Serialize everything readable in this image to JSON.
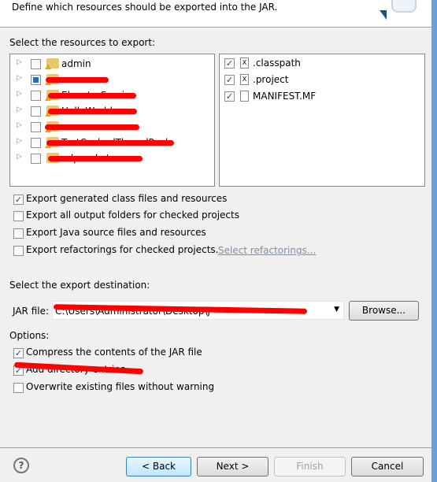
{
  "header": {
    "description": "Define which resources should be exported into the JAR.",
    "icon": "jar-export-wizard-icon"
  },
  "resources": {
    "label": "Select the resources to export:",
    "projects": [
      {
        "name": "admin",
        "checked": false,
        "warning": true
      },
      {
        "name": "",
        "checked": "partial",
        "warning": true
      },
      {
        "name": "ElevatorService",
        "checked": false,
        "warning": true
      },
      {
        "name": "HelloWorld",
        "checked": false,
        "warning": true
      },
      {
        "name": "",
        "checked": false,
        "warning": true
      },
      {
        "name": "TestCachedThreadPool",
        "checked": false,
        "warning": true
      },
      {
        "name": "udpsocket",
        "checked": false,
        "warning": false
      }
    ],
    "files": [
      {
        "name": ".classpath",
        "checked": true,
        "icon": "xml-file-icon"
      },
      {
        "name": ".project",
        "checked": true,
        "icon": "xml-file-icon"
      },
      {
        "name": "MANIFEST.MF",
        "checked": true,
        "icon": "text-file-icon"
      }
    ]
  },
  "export_options": [
    {
      "label": "Export generated class files and resources",
      "checked": true
    },
    {
      "label": "Export all output folders for checked projects",
      "checked": false
    },
    {
      "label": "Export Java source files and resources",
      "checked": false
    },
    {
      "label": "Export refactorings for checked projects.",
      "checked": false
    }
  ],
  "select_refactorings_link": "Select refactorings...",
  "destination": {
    "label": "Select the export destination:",
    "jar_label": "JAR file:",
    "jar_value": "C:\\Users\\Administrator\\Desktop\\j",
    "browse": "Browse..."
  },
  "options": {
    "label": "Options:",
    "items": [
      {
        "label": "Compress the contents of the JAR file",
        "checked": true
      },
      {
        "label": "Add directory entries",
        "checked": true
      },
      {
        "label": "Overwrite existing files without warning",
        "checked": false
      }
    ]
  },
  "buttons": {
    "back": "< Back",
    "next": "Next >",
    "finish": "Finish",
    "cancel": "Cancel",
    "help": "?"
  }
}
